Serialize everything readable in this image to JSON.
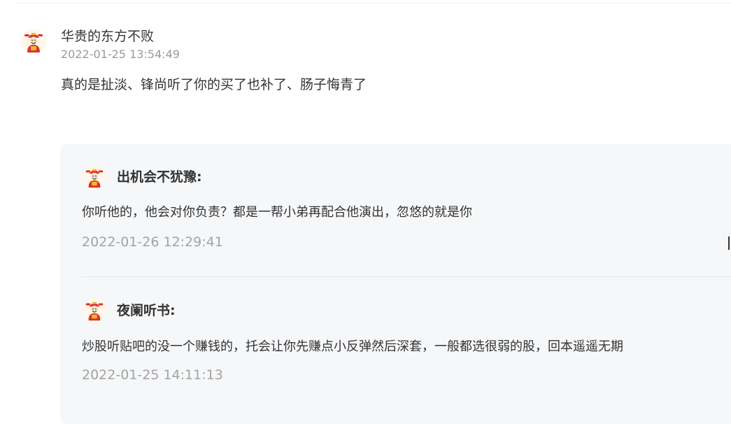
{
  "comment": {
    "author": "华贵的东方不败",
    "time": "2022-01-25 13:54:49",
    "content": "真的是扯淡、锋尚听了你的买了也补了、肠子悔青了",
    "avatar_icon": "god-of-wealth-avatar-icon"
  },
  "replies": [
    {
      "author": "出机会不犹豫:",
      "content": "你听他的，他会对你负责？都是一帮小弟再配合他演出，忽悠的就是你",
      "time": "2022-01-26 12:29:41",
      "avatar_icon": "god-of-wealth-avatar-icon"
    },
    {
      "author": "夜阑听书:",
      "content": "炒股听贴吧的没一个赚钱的，托会让你先赚点小反弹然后深套，一般都选很弱的股，回本遥遥无期",
      "time": "2022-01-25 14:11:13",
      "avatar_icon": "god-of-wealth-avatar-icon"
    }
  ],
  "colors": {
    "text": "#333333",
    "timestamp": "#9a9a9a",
    "reply_background": "#f6f7f9",
    "avatar_hat": "#d9332b",
    "avatar_gold": "#f2b631"
  }
}
